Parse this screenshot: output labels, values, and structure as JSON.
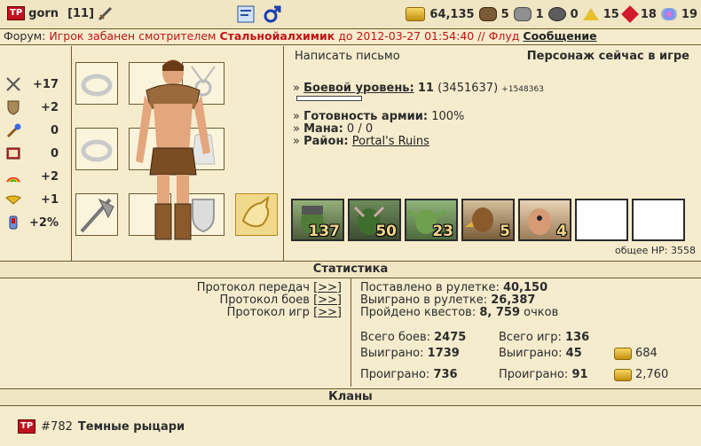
{
  "header": {
    "tp_badge": "TP",
    "nick": "gorn",
    "level": "[11]",
    "resources": [
      {
        "icon": "gold-icon",
        "value": "64,135"
      },
      {
        "icon": "wood-icon",
        "value": "5"
      },
      {
        "icon": "ore-icon",
        "value": "1"
      },
      {
        "icon": "mercury-icon",
        "value": "0"
      },
      {
        "icon": "sulfur-icon",
        "value": "15"
      },
      {
        "icon": "crystal-icon",
        "value": "18"
      },
      {
        "icon": "gems-icon",
        "value": "19"
      }
    ]
  },
  "forum": {
    "prefix": "Форум:",
    "ban_text": "Игрок забанен смотрителем",
    "moderator": "Стальнойалхимик",
    "until": "до 2012-03-27 01:54:40 // Флуд",
    "link": "Сообщение"
  },
  "stats": [
    {
      "icon": "attack-icon",
      "value": "+17"
    },
    {
      "icon": "defense-icon",
      "value": "+2"
    },
    {
      "icon": "spellpower-icon",
      "value": "0"
    },
    {
      "icon": "knowledge-icon",
      "value": "0"
    },
    {
      "icon": "luck-icon",
      "value": "+2"
    },
    {
      "icon": "morale-icon",
      "value": "+1"
    },
    {
      "icon": "initiative-icon",
      "value": "+2%"
    }
  ],
  "info": {
    "write_letter": "Написать письмо",
    "online": "Персонаж сейчас в игре",
    "combat_level_label": "Боевой уровень:",
    "combat_level_value": "11",
    "combat_exp": "(3451637)",
    "combat_exp_need": "+1548363",
    "army_ready_label": "Готовность армии:",
    "army_ready_value": "100%",
    "mana_label": "Мана:",
    "mana_value": "0 / 0",
    "district_label": "Район:",
    "district_value": "Portal's Ruins",
    "army": [
      "137",
      "50",
      "23",
      "5",
      "4",
      "",
      ""
    ],
    "total_hp": "общее HP: 3558"
  },
  "statistics": {
    "title": "Статистика",
    "links": [
      {
        "label": "Протокол передач",
        "link": "[>>]"
      },
      {
        "label": "Протокол боев",
        "link": "[>>]"
      },
      {
        "label": "Протокол игр",
        "link": "[>>]"
      }
    ],
    "roulette_bet_label": "Поставлено в рулетке:",
    "roulette_bet_value": "40,150",
    "roulette_won_label": "Выиграно в рулетке:",
    "roulette_won_value": "26,387",
    "quests_label": "Пройдено квестов:",
    "quests_value": "8, 759",
    "quests_unit": "очков",
    "battles_total_label": "Всего боев:",
    "battles_total_value": "2475",
    "battles_won_label": "Выиграно:",
    "battles_won_value": "1739",
    "battles_lost_label": "Проиграно:",
    "battles_lost_value": "736",
    "games_total_label": "Всего игр:",
    "games_total_value": "136",
    "games_won_label": "Выиграно:",
    "games_won_value": "45",
    "games_lost_label": "Проиграно:",
    "games_lost_value": "91",
    "gold_won": "684",
    "gold_lost": "2,760"
  },
  "clans": {
    "title": "Кланы",
    "clan_badge": "TP",
    "clan_id": "#782",
    "clan_name": "Темные рыцари"
  }
}
